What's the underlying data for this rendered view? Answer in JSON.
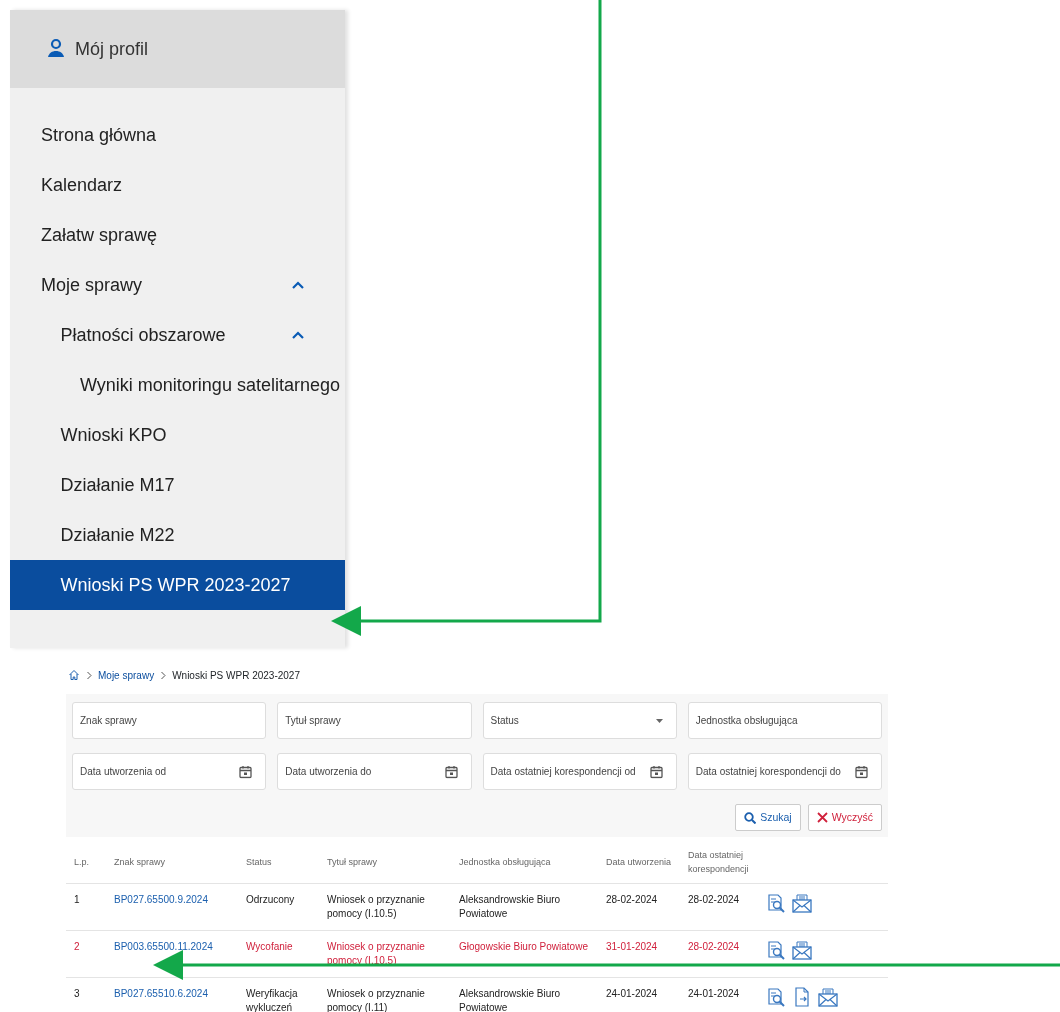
{
  "sidebar": {
    "profile": "Mój profil",
    "items": [
      {
        "label": "Strona główna",
        "selected": false
      },
      {
        "label": "Kalendarz",
        "selected": false
      },
      {
        "label": "Załatw sprawę",
        "selected": false
      },
      {
        "label": "Moje sprawy",
        "selected": false,
        "expanded": true,
        "children": [
          {
            "label": "Płatności obszarowe",
            "selected": false,
            "expanded": true,
            "children": [
              {
                "label": "Wyniki monitoringu satelitarnego",
                "selected": false
              }
            ]
          },
          {
            "label": "Wnioski KPO",
            "selected": false
          },
          {
            "label": "Działanie M17",
            "selected": false
          },
          {
            "label": "Działanie M22",
            "selected": false
          },
          {
            "label": "Wnioski PS WPR 2023-2027",
            "selected": true
          }
        ]
      }
    ]
  },
  "breadcrumb": [
    "Moje sprawy",
    "Wnioski PS WPR 2023-2027"
  ],
  "filters": [
    {
      "kind": "text",
      "placeholder": "Znak sprawy"
    },
    {
      "kind": "text",
      "placeholder": "Tytuł sprawy"
    },
    {
      "kind": "select",
      "placeholder": "Status"
    },
    {
      "kind": "text",
      "placeholder": "Jednostka obsługująca"
    },
    {
      "kind": "date",
      "placeholder": "Data utworzenia od"
    },
    {
      "kind": "date",
      "placeholder": "Data utworzenia do"
    },
    {
      "kind": "date",
      "placeholder": "Data ostatniej korespondencji od"
    },
    {
      "kind": "date",
      "placeholder": "Data ostatniej korespondencji do"
    }
  ],
  "buttons": [
    {
      "kind": "search",
      "label": "Szukaj"
    },
    {
      "kind": "clear",
      "label": "Wyczyść"
    }
  ],
  "table": {
    "columns": [
      "L.p.",
      "Znak sprawy",
      "Status",
      "Tytuł sprawy",
      "Jednostka obsługująca",
      "Data utworzenia",
      "Data ostatniej korespondencji"
    ],
    "rows": [
      {
        "highlighted": false,
        "cells": [
          "1",
          "BP027.65500.9.2024",
          "Odrzucony",
          "Wniosek o przyznanie pomocy (I.10.5)",
          "Aleksandrowskie Biuro Powiatowe",
          "28-02-2024",
          "28-02-2024"
        ],
        "actions": [
          {
            "kind": "preview"
          },
          {
            "kind": "mail"
          }
        ]
      },
      {
        "highlighted": true,
        "cells": [
          "2",
          "BP003.65500.11.2024",
          "Wycofanie",
          "Wniosek o przyznanie pomocy (I.10.5)",
          "Głogowskie Biuro Powiatowe",
          "31-01-2024",
          "28-02-2024"
        ],
        "actions": [
          {
            "kind": "preview"
          },
          {
            "kind": "mail"
          }
        ]
      },
      {
        "highlighted": false,
        "cells": [
          "3",
          "BP027.65510.6.2024",
          "Weryfikacja wykluczeń",
          "Wniosek o przyznanie pomocy (I.11)",
          "Aleksandrowskie Biuro Powiatowe",
          "24-01-2024",
          "24-01-2024"
        ],
        "actions": [
          {
            "kind": "preview"
          },
          {
            "kind": "document"
          },
          {
            "kind": "mail"
          }
        ]
      }
    ]
  }
}
